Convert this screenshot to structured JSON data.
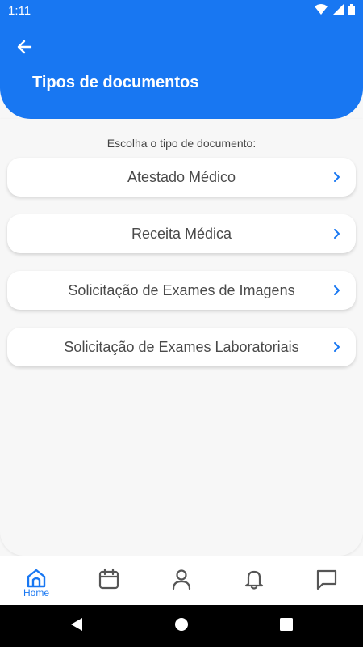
{
  "status_bar": {
    "time": "1:11"
  },
  "header": {
    "title": "Tipos de documentos",
    "back_icon": "arrow-left-icon"
  },
  "prompt": "Escolha o tipo de documento:",
  "documents": [
    {
      "label": "Atestado Médico"
    },
    {
      "label": "Receita Médica"
    },
    {
      "label": "Solicitação de Exames de Imagens"
    },
    {
      "label": "Solicitação de Exames Laboratoriais"
    }
  ],
  "bottom_nav": {
    "items": [
      {
        "icon": "home-icon",
        "label": "Home",
        "active": true
      },
      {
        "icon": "calendar-icon",
        "label": ""
      },
      {
        "icon": "person-icon",
        "label": ""
      },
      {
        "icon": "bell-icon",
        "label": ""
      },
      {
        "icon": "chat-icon",
        "label": ""
      }
    ]
  },
  "colors": {
    "primary": "#1877f2",
    "background": "#f7f7f7",
    "icon_gray": "#555555"
  }
}
